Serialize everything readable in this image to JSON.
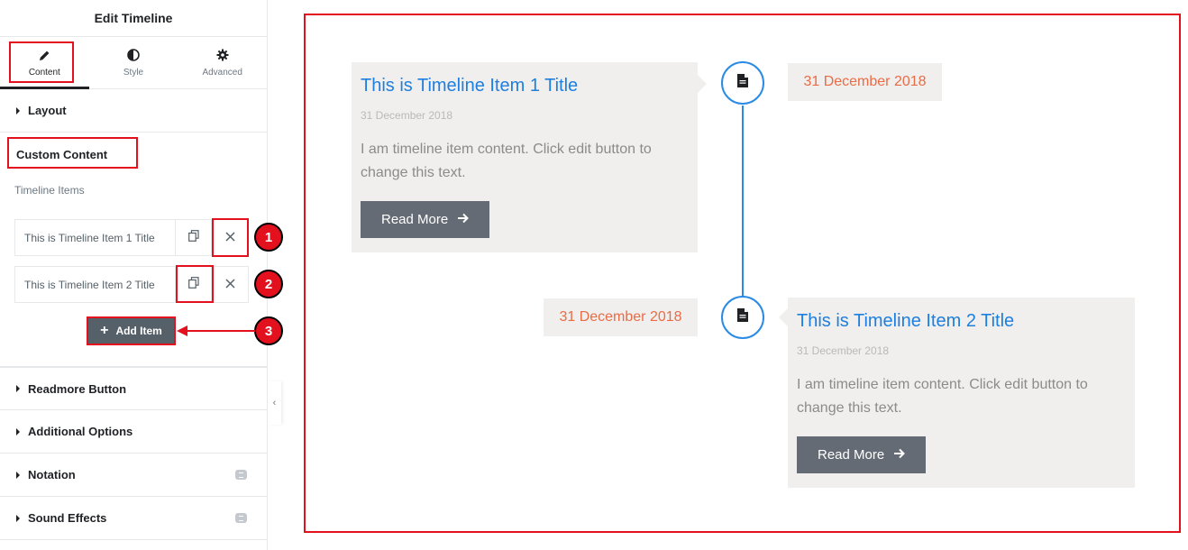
{
  "panel": {
    "title": "Edit Timeline",
    "tabs": [
      {
        "label": "Content",
        "icon": "pencil-icon"
      },
      {
        "label": "Style",
        "icon": "half-circle-icon"
      },
      {
        "label": "Advanced",
        "icon": "gear-icon"
      }
    ],
    "sections": {
      "layout": "Layout",
      "custom_content": "Custom Content",
      "readmore": "Readmore Button",
      "additional": "Additional Options",
      "notation": "Notation",
      "sound": "Sound Effects"
    },
    "timeline_items_label": "Timeline Items",
    "repeater_items": [
      {
        "title": "This is Timeline Item 1 Title"
      },
      {
        "title": "This is Timeline Item 2 Title"
      }
    ],
    "add_item_label": "Add Item",
    "badges": [
      "1",
      "2",
      "3"
    ]
  },
  "preview": {
    "items": [
      {
        "title": "This is Timeline Item 1 Title",
        "date": "31 December 2018",
        "content": "I am timeline item content. Click edit button to change this text.",
        "button": "Read More",
        "side_date": "31 December 2018"
      },
      {
        "title": "This is Timeline Item 2 Title",
        "date": "31 December 2018",
        "content": "I am timeline item content. Click edit button to change this text.",
        "button": "Read More",
        "side_date": "31 December 2018"
      }
    ]
  },
  "colors": {
    "highlight": "#e3101e",
    "link_blue": "#1d7fe0",
    "date_orange": "#e86c46",
    "button_gray": "#646b74",
    "timeline_blue": "#2b8be4"
  }
}
